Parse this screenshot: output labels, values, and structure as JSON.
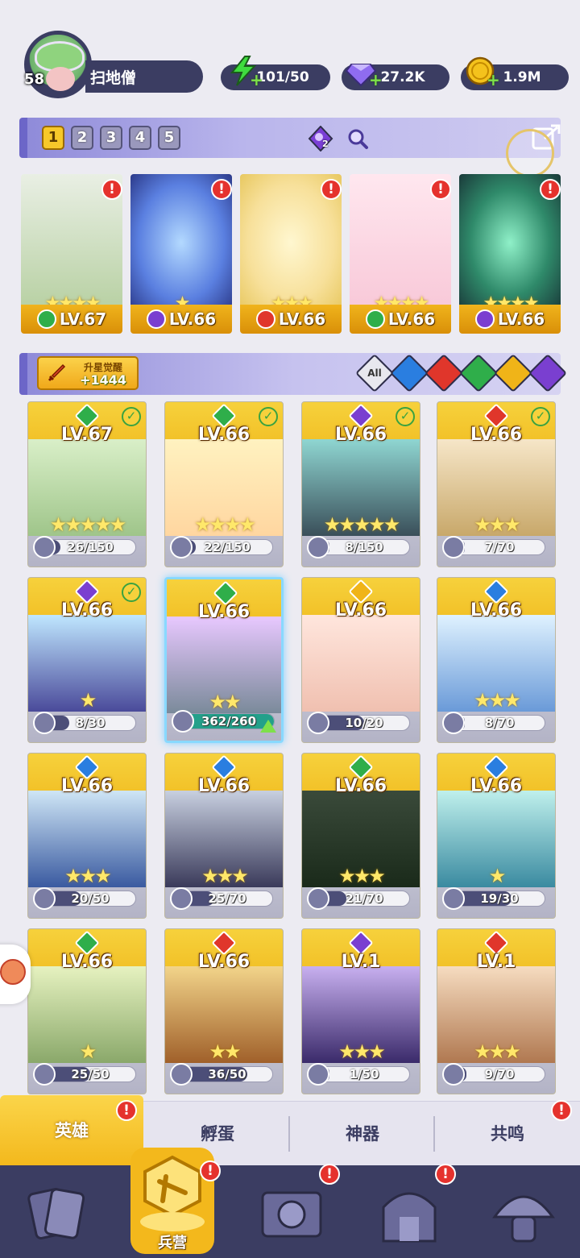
{
  "player": {
    "level": "58",
    "name": "扫地僧"
  },
  "resources": {
    "energy": "101/50",
    "gems": "27.2K",
    "coins": "1.9M"
  },
  "teams": {
    "tabs": [
      "1",
      "2",
      "3",
      "4",
      "5"
    ],
    "active": 0,
    "crystal_count": "2"
  },
  "formation": [
    {
      "level": "LV.67",
      "element": "nature",
      "stars": 4
    },
    {
      "level": "LV.66",
      "element": "dark",
      "stars": 1
    },
    {
      "level": "LV.66",
      "element": "fire",
      "stars": 3
    },
    {
      "level": "LV.66",
      "element": "nature",
      "stars": 4
    },
    {
      "level": "LV.66",
      "element": "dark",
      "stars": 4
    }
  ],
  "filter": {
    "awaken_title": "升星觉醒",
    "awaken_value": "+1444",
    "all_label": "All",
    "elements": [
      "water",
      "fire",
      "nature",
      "light",
      "dark"
    ]
  },
  "heroes": [
    {
      "level": "LV.67",
      "element": "nature",
      "progress": "26/150",
      "fill": 0.17,
      "checked": true,
      "stars": 5
    },
    {
      "level": "LV.66",
      "element": "nature",
      "progress": "22/150",
      "fill": 0.15,
      "checked": true,
      "stars": 4
    },
    {
      "level": "LV.66",
      "element": "dark",
      "progress": "8/150",
      "fill": 0.05,
      "checked": true,
      "stars": 5
    },
    {
      "level": "LV.66",
      "element": "fire",
      "progress": "7/70",
      "fill": 0.1,
      "checked": true,
      "stars": 3
    },
    {
      "level": "LV.66",
      "element": "dark",
      "progress": "8/30",
      "fill": 0.27,
      "checked": true,
      "stars": 1
    },
    {
      "level": "LV.66",
      "element": "nature",
      "progress": "362/260",
      "fill": 1.0,
      "checked": false,
      "stars": 2,
      "special": true
    },
    {
      "level": "LV.66",
      "element": "light",
      "progress": "10/20",
      "fill": 0.5,
      "checked": false,
      "stars": 0
    },
    {
      "level": "LV.66",
      "element": "water",
      "progress": "8/70",
      "fill": 0.11,
      "checked": false,
      "stars": 3
    },
    {
      "level": "LV.66",
      "element": "water",
      "progress": "20/50",
      "fill": 0.4,
      "checked": false,
      "stars": 3
    },
    {
      "level": "LV.66",
      "element": "water",
      "progress": "25/70",
      "fill": 0.36,
      "checked": false,
      "stars": 3
    },
    {
      "level": "LV.66",
      "element": "nature",
      "progress": "21/70",
      "fill": 0.3,
      "checked": false,
      "stars": 3
    },
    {
      "level": "LV.66",
      "element": "water",
      "progress": "19/30",
      "fill": 0.63,
      "checked": false,
      "stars": 1
    },
    {
      "level": "LV.66",
      "element": "nature",
      "progress": "25/50",
      "fill": 0.5,
      "checked": false,
      "stars": 1
    },
    {
      "level": "LV.66",
      "element": "fire",
      "progress": "36/50",
      "fill": 0.72,
      "checked": false,
      "stars": 2
    },
    {
      "level": "LV.1",
      "element": "dark",
      "progress": "1/50",
      "fill": 0.02,
      "checked": false,
      "stars": 3
    },
    {
      "level": "LV.1",
      "element": "fire",
      "progress": "9/70",
      "fill": 0.13,
      "checked": false,
      "stars": 3
    }
  ],
  "subtabs": [
    "英雄",
    "孵蛋",
    "神器",
    "共鸣"
  ],
  "bottom_nav": {
    "active_label": "兵营",
    "items": [
      "cards-icon",
      "barracks-icon",
      "map-icon",
      "shop-icon",
      "mushroom-icon"
    ]
  },
  "colors": {
    "nature": "#2fae4a",
    "dark": "#7a3fd0",
    "fire": "#e0362b",
    "water": "#2a7ee0",
    "light": "#f0b418",
    "panel": "#3b3d62",
    "gold": "#f3b81c"
  }
}
